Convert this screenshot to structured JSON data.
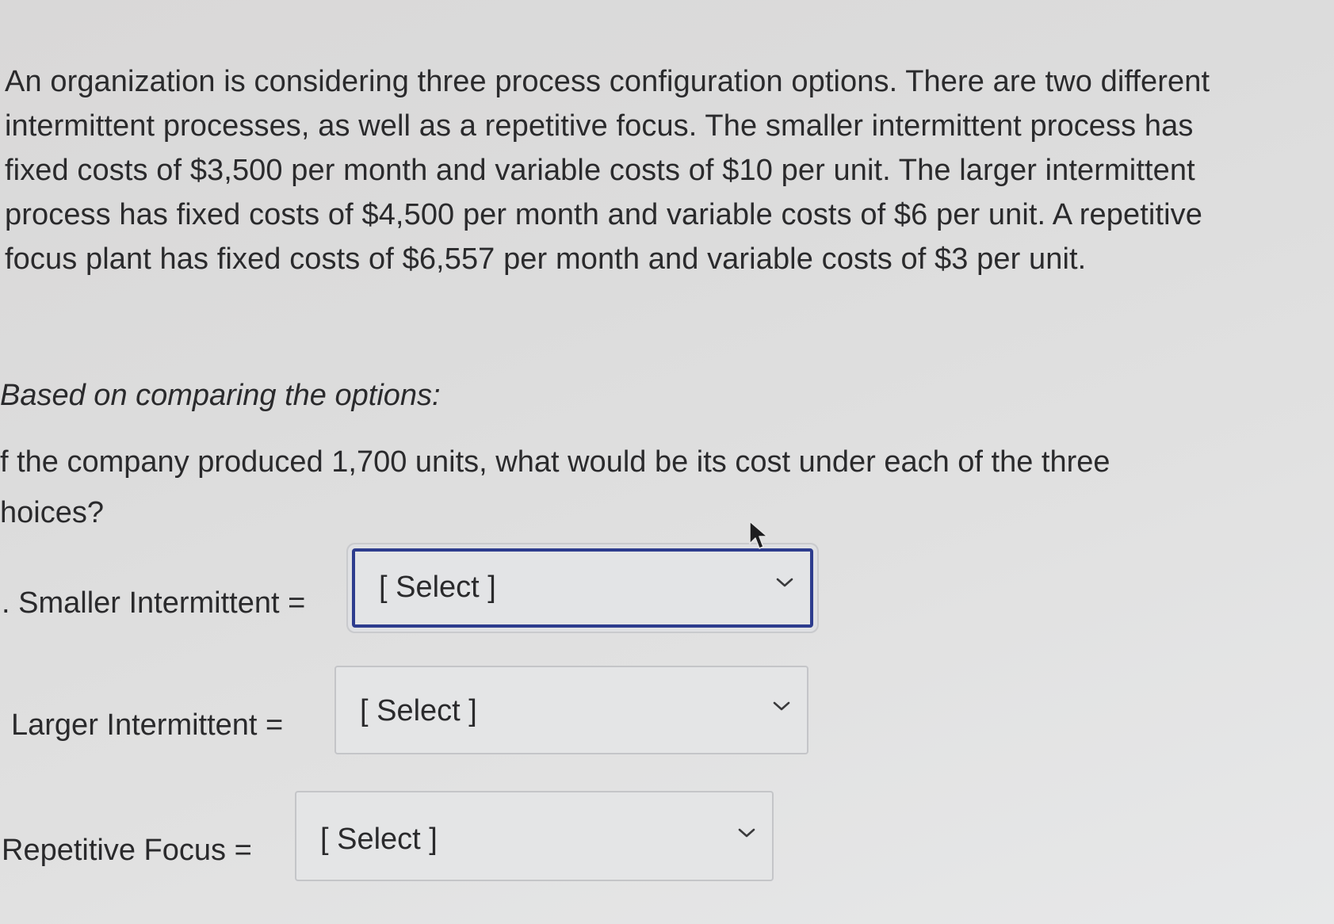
{
  "problem": {
    "lines": [
      "An organization is considering three process configuration options. There are two different",
      "intermittent processes, as well as a repetitive focus. The smaller intermittent process has",
      "fixed costs of $3,500 per month and variable costs of $10 per unit. The larger intermittent",
      "process has fixed costs of $4,500 per month and variable costs of $6 per unit. A repetitive",
      "focus plant has fixed costs of $6,557 per month and variable costs of $3 per unit."
    ]
  },
  "heading": "Based on comparing the options:",
  "question": {
    "line1": "f the company produced 1,700 units, what would be its cost under each of the three",
    "line2": "hoices?"
  },
  "fields": [
    {
      "label": ". Smaller Intermittent =",
      "selected": "[ Select ]",
      "icon": "chevron-down-icon"
    },
    {
      "label": "Larger Intermittent =",
      "selected": "[ Select ]",
      "icon": "chevron-down-icon"
    },
    {
      "label": "Repetitive Focus =",
      "selected": "[ Select ]",
      "icon": "chevron-down-icon"
    }
  ],
  "pointer": {
    "icon": "mouse-pointer-icon"
  },
  "colors": {
    "background": "#dcdcdc",
    "text": "#2a2a2c",
    "focus_border": "#2d3c8e",
    "select_border": "#c4c5c8"
  }
}
